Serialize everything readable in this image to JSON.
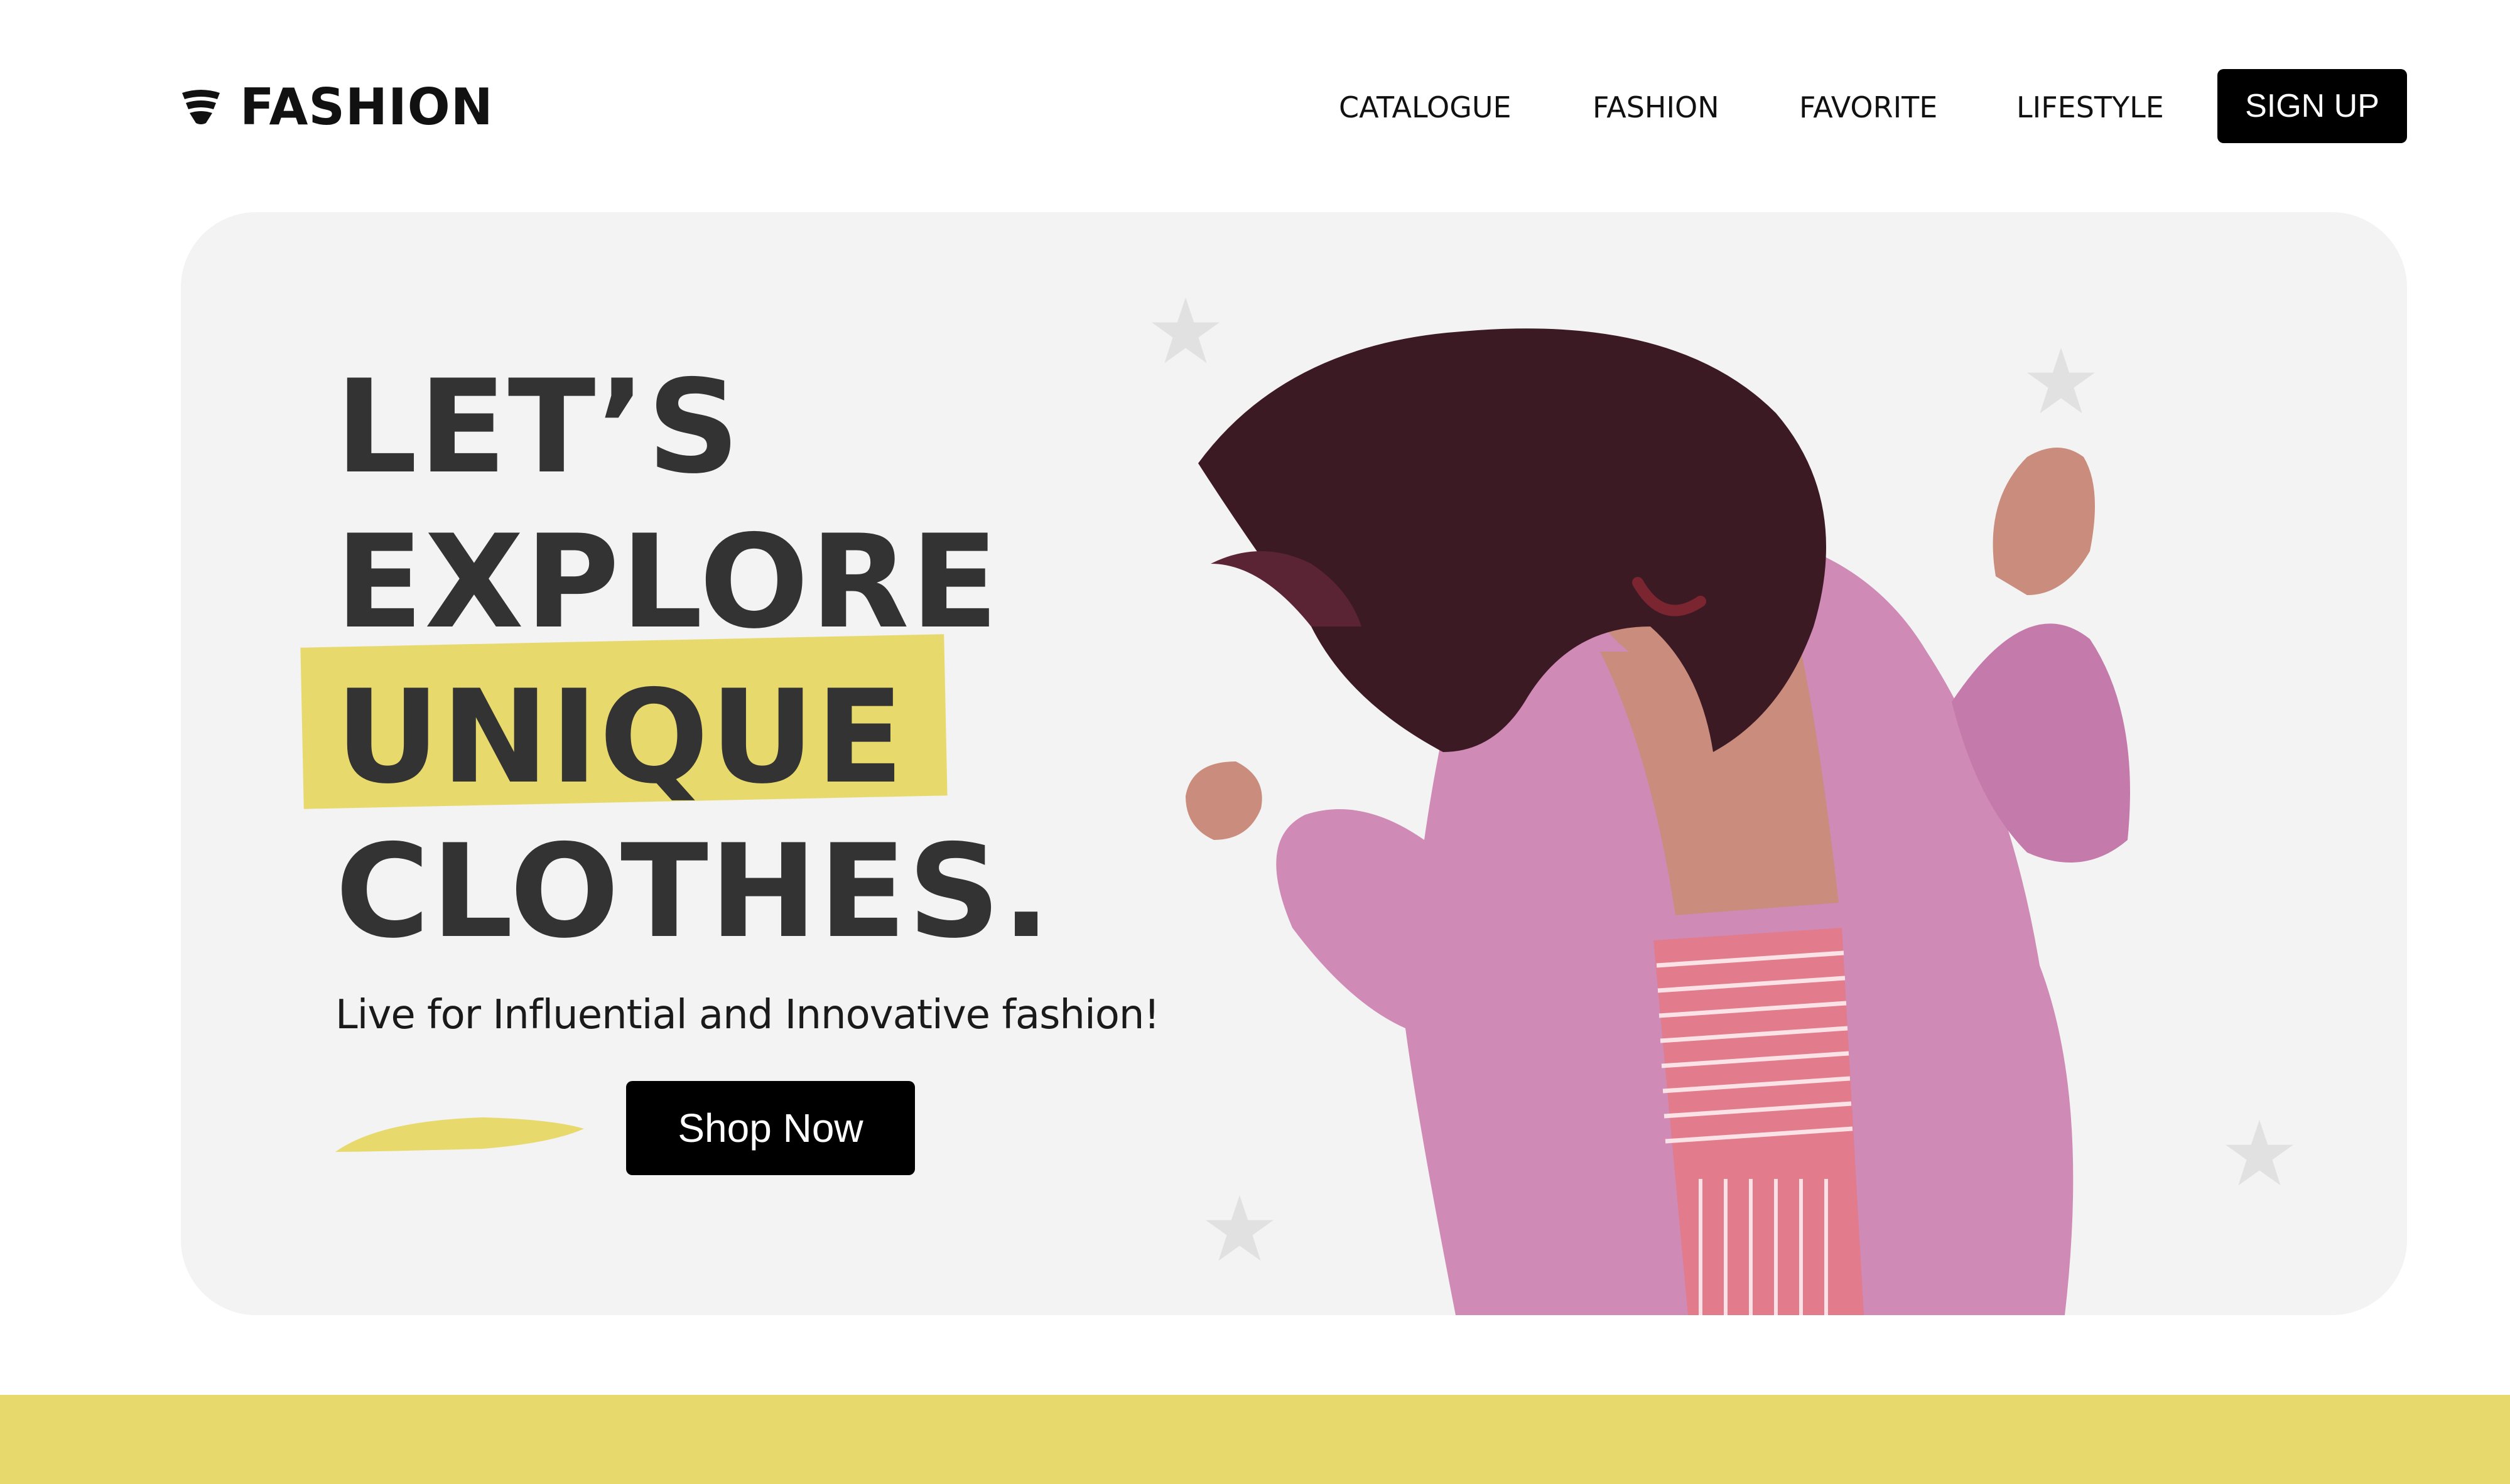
{
  "brand": {
    "name": "FASHION",
    "icon": "wifi-fan-icon"
  },
  "nav": {
    "items": [
      {
        "label": "CATALOGUE"
      },
      {
        "label": "FASHION"
      },
      {
        "label": "FAVORITE"
      },
      {
        "label": "LIFESTYLE"
      }
    ],
    "signup_label": "SIGN UP"
  },
  "hero": {
    "headline": [
      "LET’S",
      "EXPLORE",
      "UNIQUE",
      "CLOTHES."
    ],
    "tagline": "Live for Influential and Innovative fashion!",
    "cta_label": "Shop Now",
    "image_subject": "model-photo"
  },
  "colors": {
    "accent_yellow": "#e8d96c",
    "hero_bg": "#f2f3f2",
    "headline": "#333333",
    "button_bg": "#000000",
    "button_text": "#ffffff"
  }
}
